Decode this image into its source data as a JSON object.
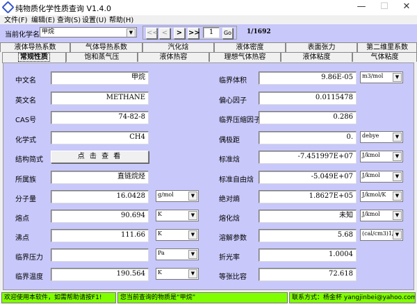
{
  "window": {
    "title": "纯物质化学性质查询 V1.4.0",
    "minimize": "—",
    "maximize": "☐",
    "close": "✕"
  },
  "menu": [
    "文件(F)",
    "编辑(E)",
    "查询(S)",
    "设置(U)",
    "帮助(H)"
  ],
  "toolbar": {
    "label": "当前化学名",
    "compound": "甲烷",
    "first": "<<",
    "prev": "<",
    "next": ">",
    "last": ">>",
    "page_input": "1",
    "go": "Go",
    "page_count": "1/1692"
  },
  "tabs_row1": [
    "液体导热系数",
    "气体导热系数",
    "汽化焓",
    "液体密度",
    "表面张力",
    "第二维里系数"
  ],
  "tabs_row2": [
    "常规性质",
    "饱和蒸气压",
    "液体热容",
    "理想气体热容",
    "液体粘度",
    "气体粘度"
  ],
  "active_tab": "常规性质",
  "left": [
    {
      "label": "中文名",
      "value": "甲烷"
    },
    {
      "label": "英文名",
      "value": "METHANE"
    },
    {
      "label": "CAS号",
      "value": "74-82-8"
    },
    {
      "label": "化学式",
      "value": "CH4"
    },
    {
      "label": "结构简式",
      "button": "点 击 查 看"
    },
    {
      "label": "所属族",
      "value": "直链烷烃"
    },
    {
      "label": "分子量",
      "value": "16.0428",
      "unit": "g/mol"
    },
    {
      "label": "熔点",
      "value": "90.694",
      "unit": "K"
    },
    {
      "label": "沸点",
      "value": "111.66",
      "unit": "K"
    },
    {
      "label": "临界压力",
      "value": "",
      "unit": "Pa"
    },
    {
      "label": "临界温度",
      "value": "190.564",
      "unit": "K"
    }
  ],
  "right": [
    {
      "label": "临界体积",
      "value": "9.86E-05",
      "unit": "m3/mol"
    },
    {
      "label": "偏心因子",
      "value": "0.0115478"
    },
    {
      "label": "临界压缩因子",
      "value": "0.286"
    },
    {
      "label": "偶极距",
      "value": "0.",
      "unit": "debye"
    },
    {
      "label": "标准焓",
      "value": "-7.451997E+07",
      "unit": "J/kmol"
    },
    {
      "label": "标准自由焓",
      "value": "-5.049E+07",
      "unit": "J/kmol"
    },
    {
      "label": "绝对熵",
      "value": "1.8627E+05",
      "unit": "J/kmol/K"
    },
    {
      "label": "熔化焓",
      "value": "未知",
      "unit": "J/kmol"
    },
    {
      "label": "溶解参数",
      "value": "5.68",
      "unit": "(cal/cm3)1/"
    },
    {
      "label": "折光率",
      "value": "1.0004"
    },
    {
      "label": "等张比容",
      "value": "72.618"
    }
  ],
  "status": {
    "help": "欢迎使用本软件，如需帮助请按F1!",
    "current": "您当前查询的物质是“甲烷”",
    "contact": "联系方式：杨金杯 yangjinbei@yahoo.com.cn"
  },
  "colors": {
    "panel": "#c8c8fa",
    "status": "#80ff00"
  }
}
